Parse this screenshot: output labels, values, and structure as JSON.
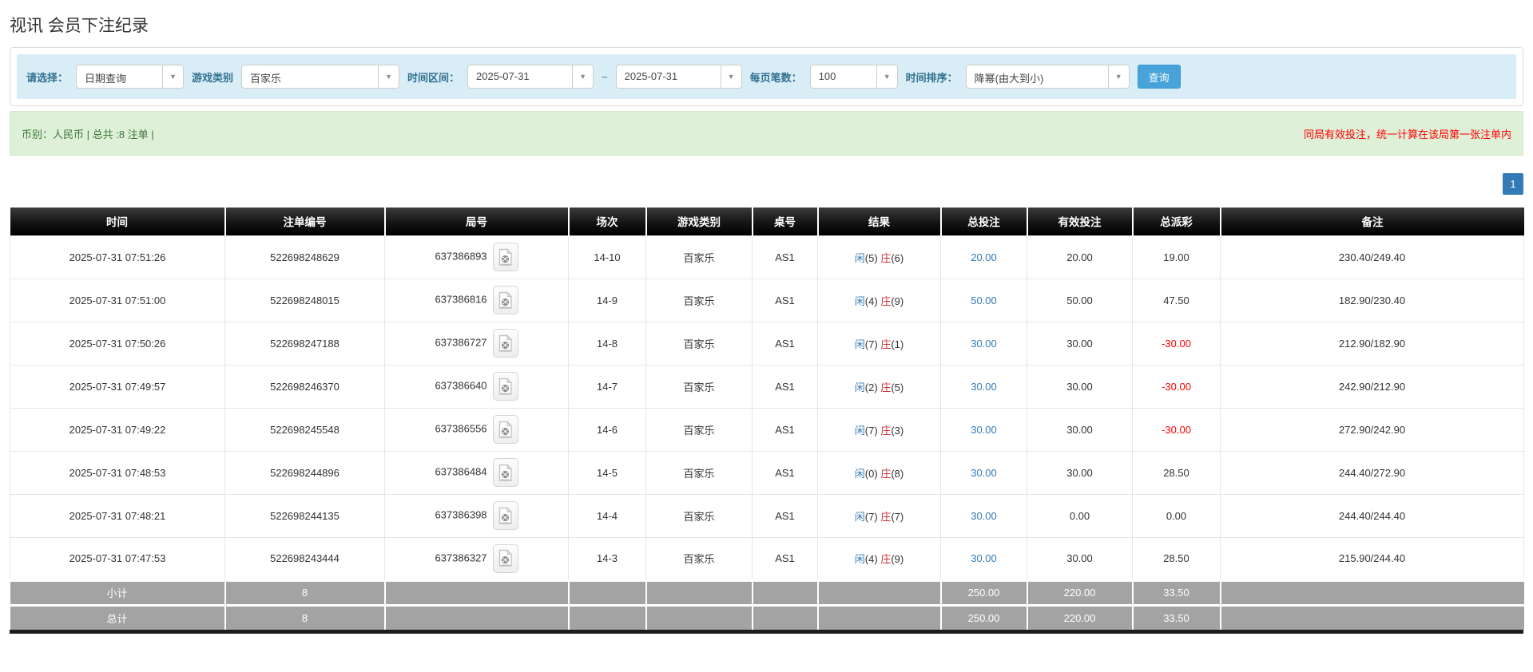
{
  "page_title": "视讯 会员下注纪录",
  "filters": {
    "select_label": "请选择：",
    "select_value": "日期查询",
    "game_type_label": "游戏类别",
    "game_type_value": "百家乐",
    "date_range_label": "时间区间：",
    "date_from": "2025-07-31",
    "date_to": "2025-07-31",
    "range_separator": "~",
    "page_size_label": "每页笔数：",
    "page_size_value": "100",
    "sort_label": "时间排序：",
    "sort_value": "降幂(由大到小)",
    "search_button": "查询"
  },
  "summary_bar": {
    "left_text": "币别：人民币 | 总共 :8 注单 |",
    "right_text": "同局有效投注，统一计算在该局第一张注单内"
  },
  "pagination": {
    "current_page": "1"
  },
  "icons": {
    "combo_caret": "▼",
    "video_icon": "video-replay-icon"
  },
  "colors": {
    "accent_blue": "#337ab7",
    "banker_red": "#cc3333",
    "negative_red": "#ff0000",
    "filter_bar_bg": "#d9edf7",
    "success_bg": "#dff0d8",
    "header_bg": "#000000",
    "footer_gray": "#a3a3a3",
    "search_btn_blue": "#47a3da"
  },
  "table": {
    "headers": [
      "时间",
      "注单编号",
      "局号",
      "场次",
      "游戏类别",
      "桌号",
      "结果",
      "总投注",
      "有效投注",
      "总派彩",
      "备注"
    ],
    "rows": [
      {
        "time": "2025-07-31 07:51:26",
        "bet_no": "522698248629",
        "round_no": "637386893",
        "session": "14-10",
        "game": "百家乐",
        "table_no": "AS1",
        "p_label": "闲",
        "p_num": "(5)",
        "b_label": "庄",
        "b_num": "(6)",
        "total_bet": "20.00",
        "valid_bet": "20.00",
        "payout": "19.00",
        "remark": "230.40/249.40"
      },
      {
        "time": "2025-07-31 07:51:00",
        "bet_no": "522698248015",
        "round_no": "637386816",
        "session": "14-9",
        "game": "百家乐",
        "table_no": "AS1",
        "p_label": "闲",
        "p_num": "(4)",
        "b_label": "庄",
        "b_num": "(9)",
        "total_bet": "50.00",
        "valid_bet": "50.00",
        "payout": "47.50",
        "remark": "182.90/230.40"
      },
      {
        "time": "2025-07-31 07:50:26",
        "bet_no": "522698247188",
        "round_no": "637386727",
        "session": "14-8",
        "game": "百家乐",
        "table_no": "AS1",
        "p_label": "闲",
        "p_num": "(7)",
        "b_label": "庄",
        "b_num": "(1)",
        "total_bet": "30.00",
        "valid_bet": "30.00",
        "payout": "-30.00",
        "remark": "212.90/182.90"
      },
      {
        "time": "2025-07-31 07:49:57",
        "bet_no": "522698246370",
        "round_no": "637386640",
        "session": "14-7",
        "game": "百家乐",
        "table_no": "AS1",
        "p_label": "闲",
        "p_num": "(2)",
        "b_label": "庄",
        "b_num": "(5)",
        "total_bet": "30.00",
        "valid_bet": "30.00",
        "payout": "-30.00",
        "remark": "242.90/212.90"
      },
      {
        "time": "2025-07-31 07:49:22",
        "bet_no": "522698245548",
        "round_no": "637386556",
        "session": "14-6",
        "game": "百家乐",
        "table_no": "AS1",
        "p_label": "闲",
        "p_num": "(7)",
        "b_label": "庄",
        "b_num": "(3)",
        "total_bet": "30.00",
        "valid_bet": "30.00",
        "payout": "-30.00",
        "remark": "272.90/242.90"
      },
      {
        "time": "2025-07-31 07:48:53",
        "bet_no": "522698244896",
        "round_no": "637386484",
        "session": "14-5",
        "game": "百家乐",
        "table_no": "AS1",
        "p_label": "闲",
        "p_num": "(0)",
        "b_label": "庄",
        "b_num": "(8)",
        "total_bet": "30.00",
        "valid_bet": "30.00",
        "payout": "28.50",
        "remark": "244.40/272.90"
      },
      {
        "time": "2025-07-31 07:48:21",
        "bet_no": "522698244135",
        "round_no": "637386398",
        "session": "14-4",
        "game": "百家乐",
        "table_no": "AS1",
        "p_label": "闲",
        "p_num": "(7)",
        "b_label": "庄",
        "b_num": "(7)",
        "total_bet": "30.00",
        "valid_bet": "0.00",
        "payout": "0.00",
        "remark": "244.40/244.40"
      },
      {
        "time": "2025-07-31 07:47:53",
        "bet_no": "522698243444",
        "round_no": "637386327",
        "session": "14-3",
        "game": "百家乐",
        "table_no": "AS1",
        "p_label": "闲",
        "p_num": "(4)",
        "b_label": "庄",
        "b_num": "(9)",
        "total_bet": "30.00",
        "valid_bet": "30.00",
        "payout": "28.50",
        "remark": "215.90/244.40"
      }
    ],
    "subtotal": {
      "label": "小计",
      "count": "8",
      "total_bet": "250.00",
      "valid_bet": "220.00",
      "payout": "33.50"
    },
    "total": {
      "label": "总计",
      "count": "8",
      "total_bet": "250.00",
      "valid_bet": "220.00",
      "payout": "33.50"
    }
  }
}
